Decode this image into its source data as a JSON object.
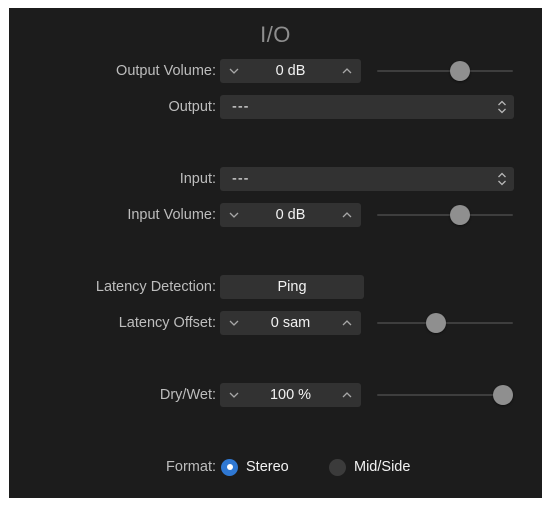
{
  "title": "I/O",
  "output_volume": {
    "label": "Output Volume:",
    "value": "0 dB",
    "slider_level": 0.63
  },
  "output": {
    "label": "Output:",
    "value": "---"
  },
  "input": {
    "label": "Input:",
    "value": "---"
  },
  "input_volume": {
    "label": "Input Volume:",
    "value": "0 dB",
    "slider_level": 0.63
  },
  "latency_detection": {
    "label": "Latency Detection:",
    "button_label": "Ping"
  },
  "latency_offset": {
    "label": "Latency Offset:",
    "value": "0 sam",
    "slider_level": 0.42
  },
  "dry_wet": {
    "label": "Dry/Wet:",
    "value": "100 %",
    "slider_level": 1.0
  },
  "format": {
    "label": "Format:",
    "options": [
      {
        "label": "Stereo",
        "selected": true
      },
      {
        "label": "Mid/Side",
        "selected": false
      }
    ]
  },
  "colors": {
    "panel_bg": "#1c1c1c",
    "control_bg": "#323232",
    "accent": "#2f78d3",
    "label_text": "#bdbdbd",
    "value_text": "#f2f2f2"
  },
  "icons": {
    "stepper_down": "chevron-down-icon",
    "stepper_up": "chevron-up-icon",
    "select_indicator": "updown-chevron-icon"
  }
}
